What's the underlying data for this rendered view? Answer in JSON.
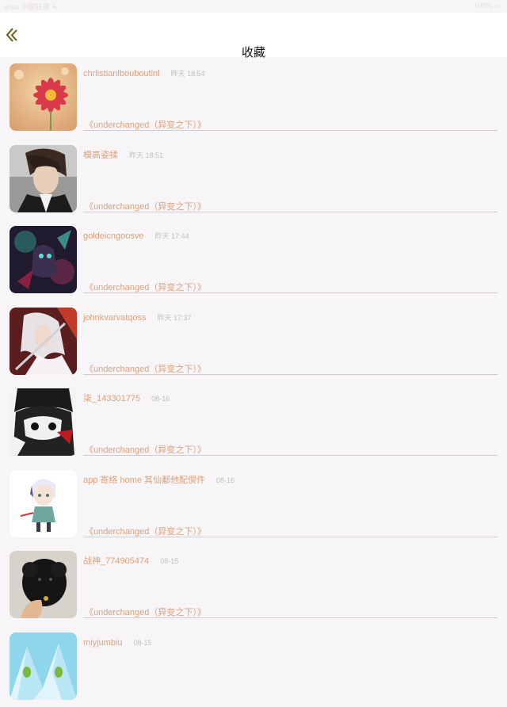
{
  "status_bar": {
    "left": "iPad 中国联通 ✦",
    "right": "100% ▭"
  },
  "header": {
    "title": "收藏",
    "back_icon": "chevron-left-icon"
  },
  "accent_color": "#dca27c",
  "items": [
    {
      "name": "chriistianlbouboutinl",
      "time": "昨天 18:54",
      "book": "《underchanged（异变之下）》",
      "avatar": "flower"
    },
    {
      "name": "模高姿揉",
      "time": "昨天 18:51",
      "book": "《underchanged（异变之下）》",
      "avatar": "boy"
    },
    {
      "name": "goldeicngoosve",
      "time": "昨天 17:44",
      "book": "《underchanged（异变之下）》",
      "avatar": "game-character"
    },
    {
      "name": "johnkvarvatqoss",
      "time": "昨天 17:37",
      "book": "《underchanged（异变之下）》",
      "avatar": "anime-swordsman"
    },
    {
      "name": "柒_143301775",
      "time": "08-16",
      "book": "《underchanged（异变之下）》",
      "avatar": "masked-figure"
    },
    {
      "name": "app 寄络 home 其仙鄱他配偰件",
      "time": "08-16",
      "book": "《underchanged（异变之下）》",
      "avatar": "chibi-character"
    },
    {
      "name": "战神_774905474",
      "time": "08-15",
      "book": "《underchanged（异变之下）》",
      "avatar": "black-puppy"
    },
    {
      "name": "miyjumbiu",
      "time": "08-15",
      "book": "",
      "avatar": "ice-mountain"
    }
  ]
}
